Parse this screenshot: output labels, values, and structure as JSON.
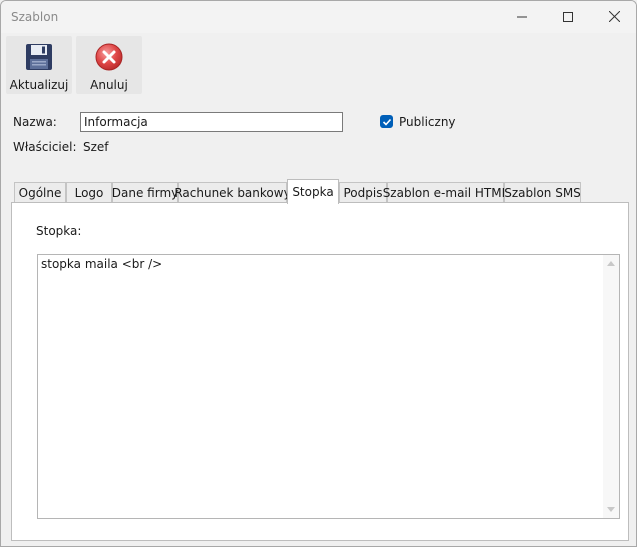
{
  "window": {
    "title": "Szablon"
  },
  "toolbar": {
    "update_label": "Aktualizuj",
    "cancel_label": "Anuluj",
    "update_icon": "floppy-disk-icon",
    "cancel_icon": "red-x-circle-icon"
  },
  "form": {
    "name_label": "Nazwa:",
    "name_value": "Informacja",
    "public_label": "Publiczny",
    "public_checked": true,
    "owner_label": "Właściciel:",
    "owner_value": "Szef"
  },
  "tabs": [
    {
      "label": "Ogólne",
      "active": false
    },
    {
      "label": "Logo",
      "active": false
    },
    {
      "label": "Dane firmy",
      "active": false
    },
    {
      "label": "Rachunek bankowy",
      "active": false
    },
    {
      "label": "Stopka",
      "active": true
    },
    {
      "label": "Podpis",
      "active": false
    },
    {
      "label": "Szablon e-mail HTML",
      "active": false
    },
    {
      "label": "Szablon SMS",
      "active": false
    }
  ],
  "panel": {
    "label": "Stopka:",
    "content": "stopka maila <br />"
  },
  "colors": {
    "accent": "#005fb8",
    "cancel_red": "#e04848"
  }
}
